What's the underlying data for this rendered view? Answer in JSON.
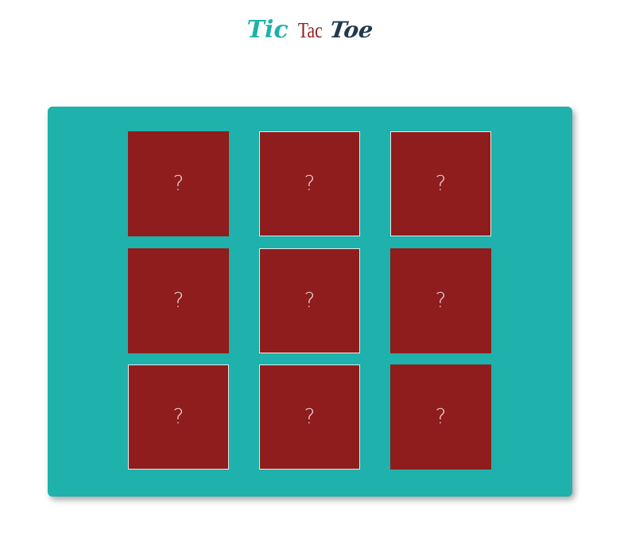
{
  "header": {
    "title_part1": "Tic",
    "title_part2": "Tac",
    "title_part3": "Toe"
  },
  "colors": {
    "board": "#1fb1ab",
    "cell": "#8f1d1d",
    "title_tic": "#1fb1ab",
    "title_tac": "#8f1d1d",
    "title_toe": "#1f3a4d"
  },
  "board": {
    "cells": [
      {
        "label": "?",
        "outlined": false
      },
      {
        "label": "?",
        "outlined": true
      },
      {
        "label": "?",
        "outlined": true
      },
      {
        "label": "?",
        "outlined": false
      },
      {
        "label": "?",
        "outlined": true
      },
      {
        "label": "?",
        "outlined": false
      },
      {
        "label": "?",
        "outlined": true
      },
      {
        "label": "?",
        "outlined": true
      },
      {
        "label": "?",
        "outlined": false
      }
    ]
  }
}
